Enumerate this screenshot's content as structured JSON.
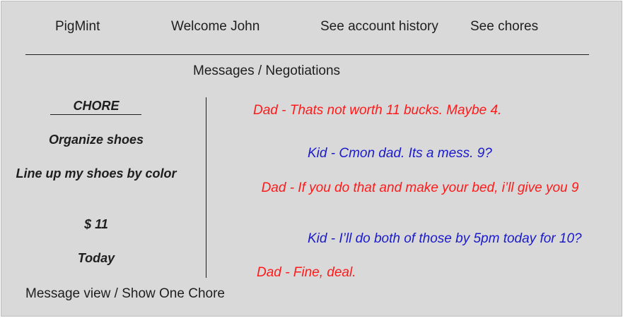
{
  "header": {
    "brand": "PigMint",
    "welcome": "Welcome John",
    "nav": {
      "history": "See account history",
      "chores": "See chores"
    }
  },
  "section_title": "Messages / Negotiations",
  "chore": {
    "heading": "CHORE",
    "name": "Organize shoes",
    "description": "Line up my shoes by color",
    "amount": "$ 11",
    "due": "Today"
  },
  "messages": [
    {
      "sender": "dad",
      "text": "Dad - Thats not worth 11 bucks. Maybe 4."
    },
    {
      "sender": "kid",
      "text": "Kid - Cmon dad. Its a mess. 9?"
    },
    {
      "sender": "dad",
      "text": "Dad - If you do that and make your bed, i’ll give you 9"
    },
    {
      "sender": "kid",
      "text": "Kid - I’ll do both of those by 5pm today for 10?"
    },
    {
      "sender": "dad",
      "text": "Dad - Fine, deal."
    }
  ],
  "footer_label": "Message view / Show One Chore",
  "colors": {
    "background": "#d9d9d9",
    "text": "#1e1e1e",
    "dad_message": "#ff1a1a",
    "kid_message": "#1a1acc"
  }
}
